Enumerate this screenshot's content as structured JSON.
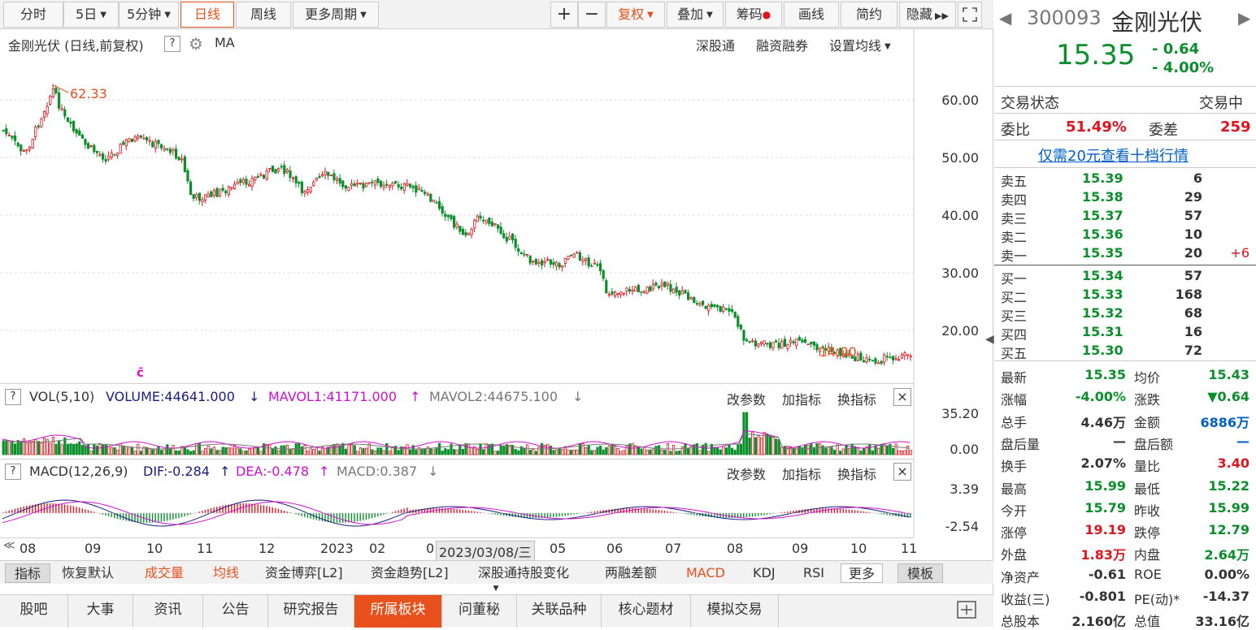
{
  "toolbar": {
    "periods": [
      "分时",
      "5日",
      "5分钟",
      "日线",
      "周线",
      "更多周期"
    ],
    "tools": [
      "复权",
      "叠加",
      "筹码",
      "画线",
      "简约",
      "隐藏"
    ]
  },
  "chart_header": {
    "title": "金刚光伏 (日线,前复权)",
    "ma": "MA",
    "links": [
      "深股通",
      "融资融券",
      "设置均线"
    ]
  },
  "price_axis": [
    "60.00",
    "50.00",
    "40.00",
    "30.00",
    "20.00"
  ],
  "annotations": {
    "high": "62.33",
    "low": "14.00"
  },
  "vol_header": {
    "name": "VOL(5,10)",
    "volume": "VOLUME:44641.000",
    "mavol1": "MAVOL1:41171.000",
    "mavol2": "MAVOL2:44675.100",
    "links": [
      "改参数",
      "加指标",
      "换指标"
    ]
  },
  "vol_axis": [
    "35.20",
    "0.00"
  ],
  "macd_header": {
    "name": "MACD(12,26,9)",
    "dif": "DIF:-0.284",
    "dea": "DEA:-0.478",
    "macd": "MACD:0.387",
    "links": [
      "改参数",
      "加指标",
      "换指标"
    ]
  },
  "macd_axis": [
    "3.39",
    "-2.54"
  ],
  "months": [
    "08",
    "09",
    "10",
    "11",
    "12",
    "2023",
    "02",
    "0",
    "05",
    "06",
    "07",
    "08",
    "09",
    "10",
    "11"
  ],
  "cursor_date": "2023/03/08/三",
  "indicators": [
    "指标",
    "恢复默认",
    "成交量",
    "均线",
    "资金博弈[L2]",
    "资金趋势[L2]",
    "深股通持股变化",
    "两融差额",
    "MACD",
    "KDJ",
    "RSI",
    "更多",
    "模板"
  ],
  "bottom_tabs": [
    "股吧",
    "大事",
    "资讯",
    "公告",
    "研究报告",
    "所属板块",
    "问董秘",
    "关联品种",
    "核心题材",
    "模拟交易"
  ],
  "quote": {
    "code": "300093",
    "name": "金刚光伏",
    "price": "15.35",
    "change": "- 0.64",
    "pct": "- 4.00%",
    "status_label": "交易状态",
    "status": "交易中",
    "wb_label": "委比",
    "wb": "51.49%",
    "wc_label": "委差",
    "wc": "259",
    "promo": "仅需20元查看十档行情",
    "asks": [
      [
        "卖五",
        "15.39",
        "6",
        ""
      ],
      [
        "卖四",
        "15.38",
        "29",
        ""
      ],
      [
        "卖三",
        "15.37",
        "57",
        ""
      ],
      [
        "卖二",
        "15.36",
        "10",
        ""
      ],
      [
        "卖一",
        "15.35",
        "20",
        "+6"
      ]
    ],
    "bids": [
      [
        "买一",
        "15.34",
        "57"
      ],
      [
        "买二",
        "15.33",
        "168"
      ],
      [
        "买三",
        "15.32",
        "68"
      ],
      [
        "买四",
        "15.31",
        "16"
      ],
      [
        "买五",
        "15.30",
        "72"
      ]
    ],
    "stats": [
      [
        "最新",
        "15.35",
        "均价",
        "15.43"
      ],
      [
        "涨幅",
        "-4.00%",
        "涨跌",
        "▼0.64"
      ],
      [
        "总手",
        "4.46万",
        "金额",
        "6886万"
      ],
      [
        "盘后量",
        "—",
        "盘后额",
        "—"
      ],
      [
        "换手",
        "2.07%",
        "量比",
        "3.40"
      ],
      [
        "最高",
        "15.99",
        "最低",
        "15.22"
      ],
      [
        "今开",
        "15.79",
        "昨收",
        "15.99"
      ],
      [
        "涨停",
        "19.19",
        "跌停",
        "12.79"
      ],
      [
        "外盘",
        "1.83万",
        "内盘",
        "2.64万"
      ],
      [
        "净资产",
        "-0.61",
        "ROE",
        "0.00%"
      ],
      [
        "收益(三)",
        "-0.801",
        "PE(动)*",
        "-14.37"
      ],
      [
        "总股本",
        "2.160亿",
        "总值",
        "33.16亿"
      ]
    ]
  },
  "colors": {
    "up": "#e0141e",
    "down": "#0a8f2a",
    "accent": "#e8501c"
  }
}
